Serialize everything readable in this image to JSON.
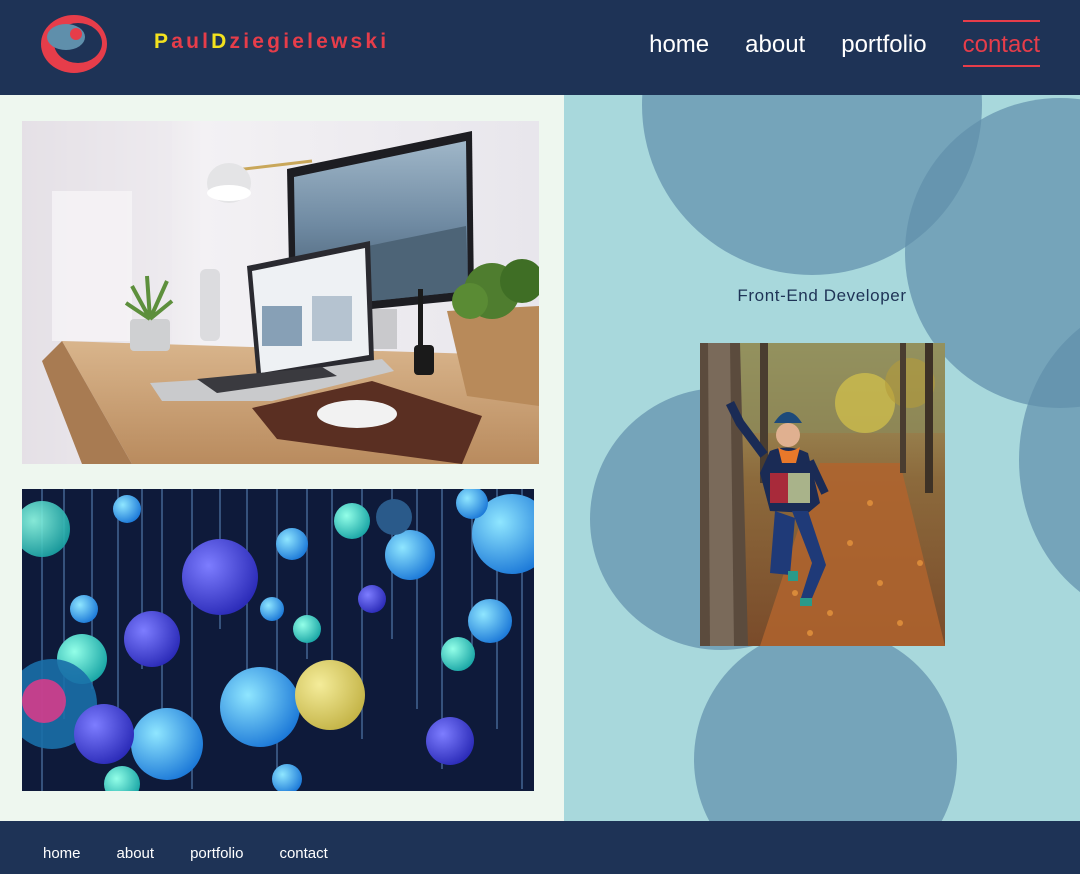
{
  "header": {
    "brand_first_initial": "P",
    "brand_first_rest": "aul",
    "brand_last_initial": "D",
    "brand_last_rest": "ziegielewski",
    "nav": [
      {
        "label": "home"
      },
      {
        "label": "about"
      },
      {
        "label": "portfolio"
      },
      {
        "label": "contact"
      }
    ],
    "active_nav": "contact"
  },
  "hero": {
    "subtitle": "Front-End Developer"
  },
  "footer": {
    "nav": [
      {
        "label": "home"
      },
      {
        "label": "about"
      },
      {
        "label": "portfolio"
      },
      {
        "label": "contact"
      }
    ]
  },
  "colors": {
    "navy": "#1e3356",
    "accent_red": "#e63d4a",
    "accent_yellow": "#f3e21e",
    "panel_teal": "#a8d8dc",
    "circle_blue": "#5f8fab",
    "page_bg": "#eef7ef"
  },
  "icons": {
    "logo": "brand-logo-icon"
  }
}
